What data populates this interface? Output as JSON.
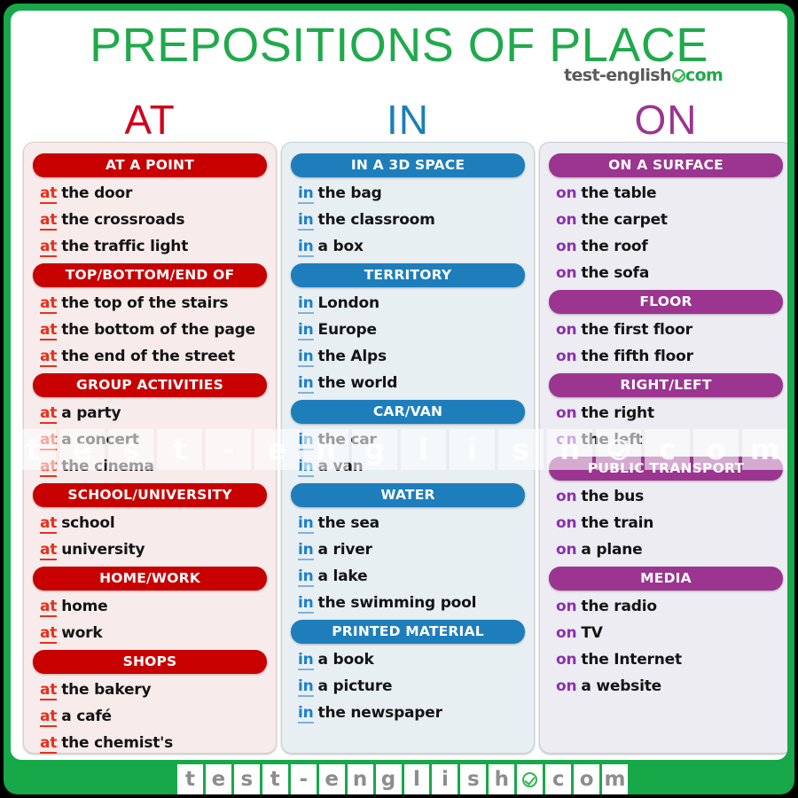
{
  "poster": {
    "title": "PREPOSITIONS OF PLACE",
    "frame_color": "#17a84a",
    "title_color": "#1faa4b"
  },
  "header_logo": {
    "brand": "test-english",
    "badge_icon": "check-circle-icon",
    "tld": "com"
  },
  "columns": [
    {
      "letter": "AT",
      "accent": "#c80000",
      "letter_color": "#d0021b",
      "preposition": "at",
      "panel_bg": "#f7eceb",
      "sections": [
        {
          "heading": "AT A POINT",
          "items": [
            "the door",
            "the crossroads",
            "the traffic light"
          ]
        },
        {
          "heading": "TOP/BOTTOM/END OF",
          "items": [
            "the top  of the stairs",
            "the bottom of the page",
            "the end of the street"
          ]
        },
        {
          "heading": "GROUP ACTIVITIES",
          "items": [
            "a party",
            "a concert",
            "the cinema"
          ]
        },
        {
          "heading": "SCHOOL/UNIVERSITY",
          "items": [
            "school",
            "university"
          ]
        },
        {
          "heading": "HOME/WORK",
          "items": [
            "home",
            "work"
          ]
        },
        {
          "heading": "SHOPS",
          "items": [
            "the bakery",
            "a café",
            "the chemist's"
          ]
        }
      ]
    },
    {
      "letter": "IN",
      "accent": "#1e7ebc",
      "letter_color": "#1a7fb8",
      "preposition": "in",
      "panel_bg": "#e8eff3",
      "sections": [
        {
          "heading": "IN A 3D SPACE",
          "items": [
            "the bag",
            "the classroom",
            "a box"
          ]
        },
        {
          "heading": "TERRITORY",
          "items": [
            "London",
            "Europe",
            "the Alps",
            "the world"
          ]
        },
        {
          "heading": "CAR/VAN",
          "items": [
            "the car",
            "a van"
          ]
        },
        {
          "heading": "WATER",
          "items": [
            "the sea",
            "a river",
            "a lake",
            "the swimming pool"
          ]
        },
        {
          "heading": "PRINTED MATERIAL",
          "items": [
            "a book",
            "a picture",
            "the newspaper"
          ]
        }
      ]
    },
    {
      "letter": "ON",
      "accent": "#9b3590",
      "letter_color": "#9b3590",
      "preposition": "on",
      "panel_bg": "#ececf2",
      "sections": [
        {
          "heading": "ON A SURFACE",
          "items": [
            "the table",
            "the carpet",
            "the roof",
            "the sofa"
          ]
        },
        {
          "heading": "FLOOR",
          "items": [
            "the first floor",
            "the fifth floor"
          ]
        },
        {
          "heading": "RIGHT/LEFT",
          "items": [
            "the right",
            "the left"
          ]
        },
        {
          "heading": "PUBLIC TRANSPORT",
          "items": [
            "the bus",
            "the train",
            "a plane"
          ]
        },
        {
          "heading": "MEDIA",
          "items": [
            "the radio",
            "TV",
            "the Internet",
            "a website"
          ]
        }
      ]
    }
  ],
  "watermark": {
    "letters": [
      "t",
      "e",
      "s",
      "t",
      "-",
      "e",
      "n",
      "g",
      "l",
      "i",
      "s",
      "h",
      "check-circle-icon",
      "c",
      "o",
      "m"
    ]
  },
  "footer": {
    "letters": [
      "t",
      "e",
      "s",
      "t",
      "-",
      "e",
      "n",
      "g",
      "l",
      "i",
      "s",
      "h",
      "check-circle-icon",
      "c",
      "o",
      "m"
    ]
  }
}
